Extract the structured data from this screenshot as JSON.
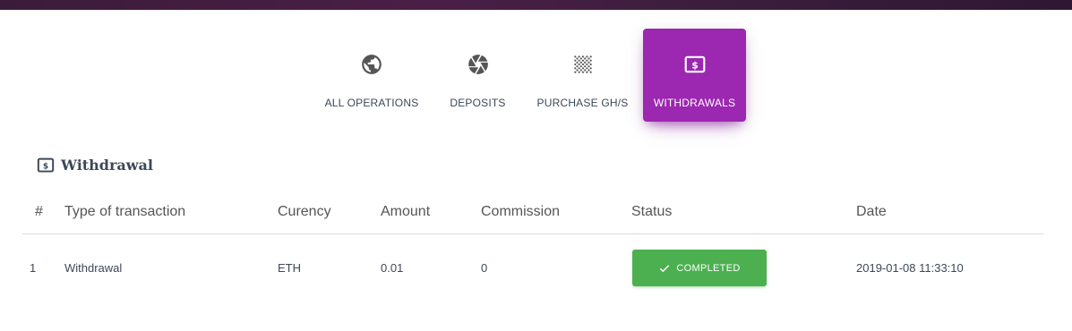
{
  "tabs": [
    {
      "label": "ALL OPERATIONS",
      "icon": "globe-icon"
    },
    {
      "label": "DEPOSITS",
      "icon": "aperture-icon"
    },
    {
      "label": "PURCHASE GH/S",
      "icon": "grain-icon"
    },
    {
      "label": "WITHDRAWALS",
      "icon": "dollar-bill-icon",
      "active": true
    }
  ],
  "section": {
    "title": "Withdrawal",
    "icon": "dollar-bill-icon"
  },
  "table": {
    "headers": [
      "#",
      "Type of transaction",
      "Curency",
      "Amount",
      "Commission",
      "Status",
      "Date"
    ],
    "rows": [
      {
        "index": "1",
        "type": "Withdrawal",
        "currency": "ETH",
        "amount": "0.01",
        "commission": "0",
        "status": "COMPLETED",
        "date": "2019-01-08 11:33:10"
      }
    ]
  },
  "colors": {
    "accent": "#9c27b0",
    "success": "#4caf50",
    "topbar": "#3b1b3a"
  }
}
